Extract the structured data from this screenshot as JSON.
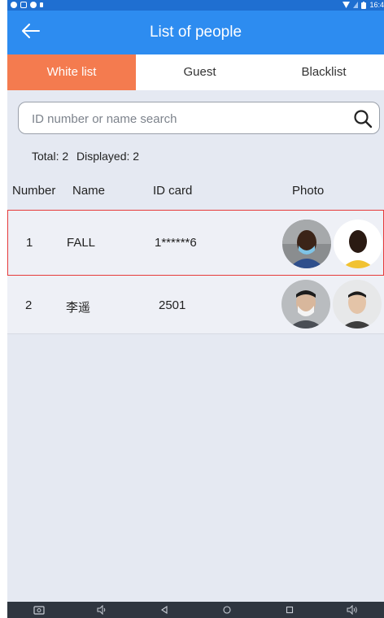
{
  "status_bar": {
    "time": "16:4"
  },
  "app_bar": {
    "title": "List of people"
  },
  "tabs": [
    {
      "label": "White list",
      "active": true
    },
    {
      "label": "Guest",
      "active": false
    },
    {
      "label": "Blacklist",
      "active": false
    }
  ],
  "search": {
    "placeholder": "ID number or name search",
    "value": ""
  },
  "summary": {
    "total": "Total: 2",
    "displayed": "Displayed: 2"
  },
  "table": {
    "columns": [
      "Number",
      "Name",
      "ID card",
      "Photo"
    ],
    "rows": [
      {
        "number": "1",
        "name": "FALL",
        "id_card": "1******6",
        "selected": true
      },
      {
        "number": "2",
        "name": "李遥",
        "id_card": "2501",
        "selected": false
      }
    ]
  },
  "colors": {
    "app_bar": "#2d8cf0",
    "status_bar": "#1f6fd1",
    "active_tab": "#f47b4f",
    "selected_row_border": "#e63a3a",
    "background": "#e5e9f2"
  },
  "icons": {
    "back": "arrow-left-icon",
    "search": "search-icon",
    "nav": [
      "screenshot-icon",
      "volume-down-icon",
      "back-triangle-icon",
      "home-circle-icon",
      "recents-square-icon",
      "volume-up-icon"
    ]
  }
}
